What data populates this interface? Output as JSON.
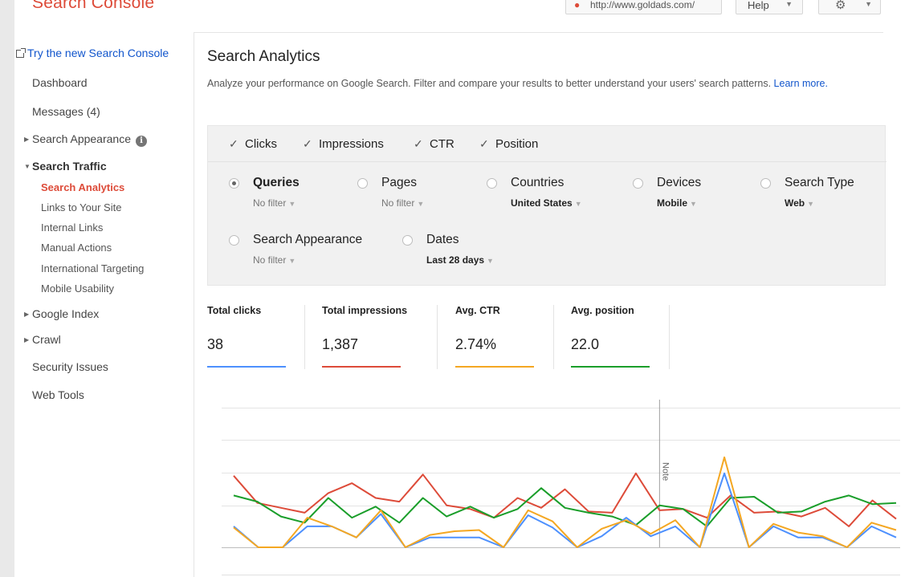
{
  "header": {
    "brand": "Search Console",
    "site": "http://www.goldads.com/",
    "help_label": "Help",
    "settings_icon": "gear-icon"
  },
  "sidebar": {
    "try_new": "Try the new Search Console",
    "items": [
      {
        "label": "Dashboard"
      },
      {
        "label": "Messages (4)"
      },
      {
        "label": "Search Appearance"
      },
      {
        "label": "Search Traffic"
      },
      {
        "label": "Search Analytics"
      },
      {
        "label": "Links to Your Site"
      },
      {
        "label": "Internal Links"
      },
      {
        "label": "Manual Actions"
      },
      {
        "label": "International Targeting"
      },
      {
        "label": "Mobile Usability"
      },
      {
        "label": "Google Index"
      },
      {
        "label": "Crawl"
      },
      {
        "label": "Security Issues"
      },
      {
        "label": "Web Tools"
      }
    ]
  },
  "main": {
    "title": "Search Analytics",
    "description": "Analyze your performance on Google Search. Filter and compare your results to better understand your users' search patterns.",
    "learn_more": "Learn more.",
    "metrics": [
      {
        "label": "Clicks",
        "checked": true
      },
      {
        "label": "Impressions",
        "checked": true
      },
      {
        "label": "CTR",
        "checked": true
      },
      {
        "label": "Position",
        "checked": true
      }
    ],
    "dimensions": [
      {
        "label": "Queries",
        "filter": "No filter",
        "selected": true
      },
      {
        "label": "Pages",
        "filter": "No filter",
        "selected": false
      },
      {
        "label": "Countries",
        "filter": "United States",
        "selected": false
      },
      {
        "label": "Devices",
        "filter": "Mobile",
        "selected": false
      },
      {
        "label": "Search Type",
        "filter": "Web",
        "selected": false
      },
      {
        "label": "Search Appearance",
        "filter": "No filter",
        "selected": false
      },
      {
        "label": "Dates",
        "filter": "Last 28 days",
        "selected": false
      }
    ],
    "totals": [
      {
        "label": "Total clicks",
        "value": "38",
        "color": "#4d90fe"
      },
      {
        "label": "Total impressions",
        "value": "1,387",
        "color": "#dd4b39"
      },
      {
        "label": "Avg. CTR",
        "value": "2.74%",
        "color": "#f4a722"
      },
      {
        "label": "Avg. position",
        "value": "22.0",
        "color": "#1a9e2a"
      }
    ]
  },
  "chart_data": {
    "type": "line",
    "note_label": "Note",
    "note_index": 18,
    "series": [
      {
        "color": "#dd4b39",
        "values": [
          58,
          36,
          32,
          28,
          44,
          52,
          40,
          37,
          59,
          34,
          31,
          24,
          40,
          32,
          47,
          29,
          28,
          60,
          30,
          31,
          24,
          42,
          28,
          29,
          25,
          32,
          17,
          38,
          23
        ]
      },
      {
        "color": "#1a9e2a",
        "values": [
          42,
          37,
          25,
          20,
          40,
          24,
          33,
          20,
          40,
          25,
          33,
          24,
          31,
          48,
          32,
          28,
          25,
          18,
          34,
          31,
          17,
          40,
          41,
          28,
          29,
          37,
          42,
          35,
          36
        ]
      },
      {
        "color": "#4d90fe",
        "values": [
          17,
          0,
          0,
          17,
          17,
          8,
          27,
          0,
          8,
          8,
          8,
          0,
          26,
          16,
          0,
          9,
          24,
          9,
          17,
          0,
          60,
          0,
          17,
          8,
          8,
          0,
          17,
          8
        ]
      },
      {
        "color": "#f4a722",
        "values": [
          16,
          0,
          0,
          24,
          17,
          8,
          30,
          0,
          10,
          13,
          14,
          0,
          30,
          21,
          0,
          15,
          22,
          11,
          22,
          0,
          73,
          0,
          19,
          12,
          9,
          0,
          20,
          14
        ]
      }
    ]
  }
}
